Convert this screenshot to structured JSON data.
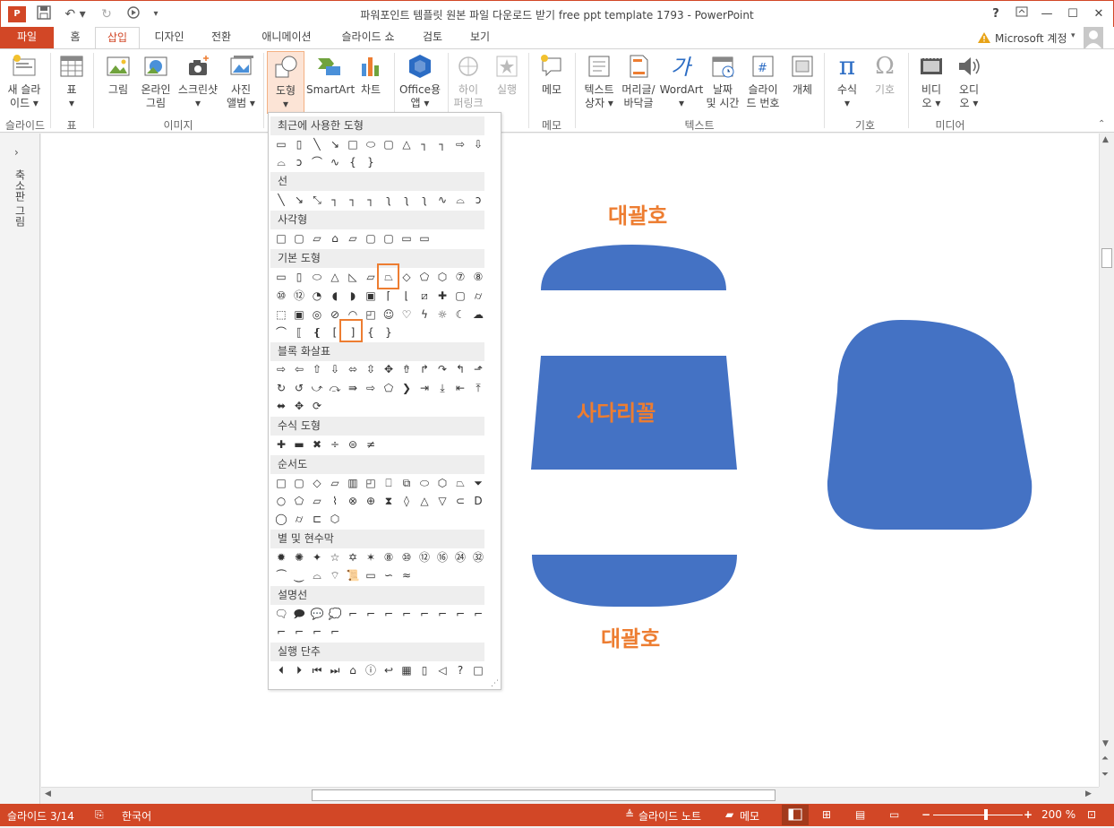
{
  "window": {
    "title": "파워포인트 템플릿 원본 파일 다운로드 받기 free ppt template 1793 - PowerPoint",
    "help": "?",
    "account": "Microsoft 계정"
  },
  "tabs": [
    {
      "label": "파일",
      "state": "file"
    },
    {
      "label": "홈"
    },
    {
      "label": "삽입",
      "state": "active"
    },
    {
      "label": "디자인"
    },
    {
      "label": "전환"
    },
    {
      "label": "애니메이션"
    },
    {
      "label": "슬라이드 쇼"
    },
    {
      "label": "검토"
    },
    {
      "label": "보기"
    }
  ],
  "ribbon": {
    "new_slide": "새 슬라\n이드 ▾",
    "table": "표\n▾",
    "picture": "그림",
    "online_picture": "온라인\n그림",
    "screenshot": "스크린샷\n▾",
    "photo_album": "사진\n앨범 ▾",
    "shapes": "도형\n▾",
    "smartart": "SmartArt",
    "chart": "차트",
    "office_apps": "Office용\n앱 ▾",
    "hyperlink": "하이\n퍼링크",
    "action": "실행",
    "comment": "메모",
    "textbox": "텍스트\n상자 ▾",
    "header_footer": "머리글/\n바닥글",
    "wordart": "WordArt\n▾",
    "date_time": "날짜\n및 시간",
    "slide_number": "슬라이\n드 번호",
    "object": "개체",
    "equation": "수식\n▾",
    "symbol": "기호",
    "video": "비디\n오 ▾",
    "audio": "오디\n오 ▾",
    "groups": {
      "slides": "슬라이드",
      "tables": "표",
      "images": "이미지",
      "comments": "메모",
      "text": "텍스트",
      "symbols": "기호",
      "media": "미디어"
    }
  },
  "left_pane": {
    "label": "축소판 그림"
  },
  "gallery": {
    "sections": [
      "최근에 사용한 도형",
      "선",
      "사각형",
      "기본 도형",
      "블록 화살표",
      "수식 도형",
      "순서도",
      "별 및 현수막",
      "설명선",
      "실행 단추"
    ]
  },
  "slide": {
    "label_top": "대괄호",
    "label_middle": "사다리꼴",
    "label_bottom": "대괄호",
    "shape_color": "#4472c4",
    "label_color": "#ed7d31"
  },
  "status": {
    "slide_counter": "슬라이드 3/14",
    "language": "한국어",
    "notes": "슬라이드 노트",
    "comments": "메모",
    "zoom": "200 %"
  }
}
